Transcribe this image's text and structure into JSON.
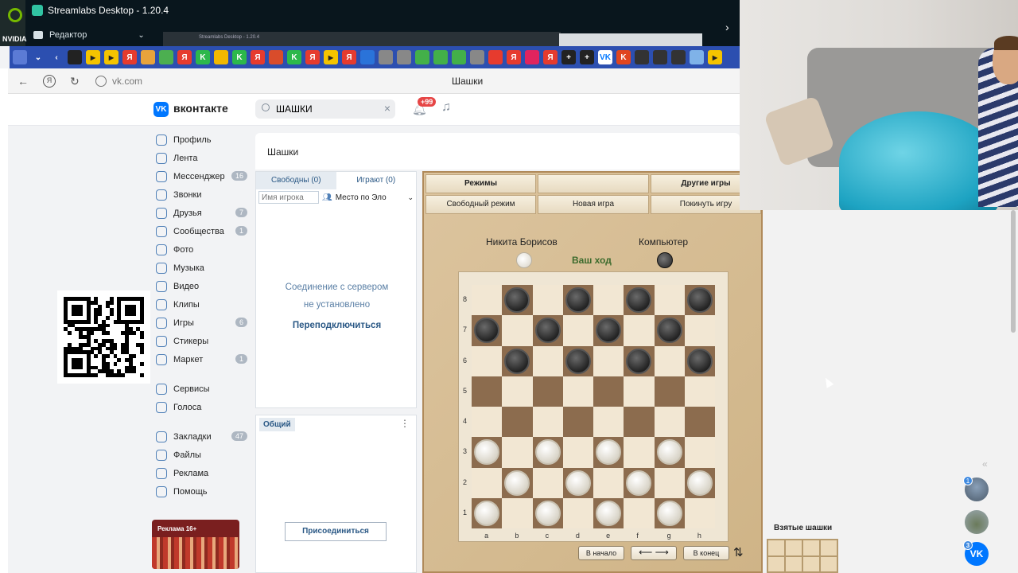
{
  "streamlabs": {
    "nvidia_label": "NVIDIA",
    "app_title": "Streamlabs Desktop - 1.20.4",
    "editor_label": "Редактор",
    "preview_title": "Streamlabs Desktop - 1.20.4"
  },
  "bookmarks": [
    {
      "icon": "smiley-icon",
      "color": "#5b7bd5"
    },
    {
      "icon": "chevron-down-icon",
      "color": "#2c4fb0"
    },
    {
      "icon": "back-icon",
      "color": "#2c4fb0"
    },
    {
      "icon": "bookmark-icon",
      "color": "#222"
    },
    {
      "icon": "play-icon",
      "color": "#f5c400"
    },
    {
      "icon": "play-icon",
      "color": "#f5c400"
    },
    {
      "icon": "yandex-icon",
      "color": "#e63b2e"
    },
    {
      "icon": "grid-icon",
      "color": "#e8a33b"
    },
    {
      "icon": "grid-icon",
      "color": "#4caf50"
    },
    {
      "icon": "yandex-icon",
      "color": "#e63b2e"
    },
    {
      "icon": "k-icon",
      "color": "#2db84b"
    },
    {
      "icon": "m-icon",
      "color": "#f2b800"
    },
    {
      "icon": "k-icon",
      "color": "#2db84b"
    },
    {
      "icon": "yandex-icon",
      "color": "#e63b2e"
    },
    {
      "icon": "circle-icon",
      "color": "#d94c2b"
    },
    {
      "icon": "k-icon",
      "color": "#2db84b"
    },
    {
      "icon": "yandex-icon",
      "color": "#e63b2e"
    },
    {
      "icon": "play-icon",
      "color": "#f5c400"
    },
    {
      "icon": "yandex-icon",
      "color": "#e63b2e"
    },
    {
      "icon": "mp-icon",
      "color": "#2a73d9"
    },
    {
      "icon": "clock-icon",
      "color": "#888"
    },
    {
      "icon": "clock-icon",
      "color": "#888"
    },
    {
      "icon": "ok-icon",
      "color": "#43b049"
    },
    {
      "icon": "ok-icon",
      "color": "#43b049"
    },
    {
      "icon": "ok-icon",
      "color": "#43b049"
    },
    {
      "icon": "clock-icon",
      "color": "#888"
    },
    {
      "icon": "pin-icon",
      "color": "#e63b2e"
    },
    {
      "icon": "yandex-icon",
      "color": "#e63b2e"
    },
    {
      "icon": "n-icon",
      "color": "#e0245e"
    },
    {
      "icon": "yandex-icon",
      "color": "#e63b2e"
    },
    {
      "icon": "plus-icon",
      "color": "#222"
    },
    {
      "icon": "plus-icon",
      "color": "#222"
    },
    {
      "icon": "vk-icon",
      "color": "#0077ff"
    },
    {
      "icon": "k-icon",
      "color": "#e0451f"
    },
    {
      "icon": "face-icon",
      "color": "#333"
    },
    {
      "icon": "face-icon",
      "color": "#333"
    },
    {
      "icon": "face-icon",
      "color": "#333"
    },
    {
      "icon": "check-icon",
      "color": "#7fb2e8"
    },
    {
      "icon": "play-icon",
      "color": "#f5c400"
    }
  ],
  "browser": {
    "url": "vk.com",
    "tab_title": "Шашки",
    "yandex_glyph": "Я"
  },
  "vk": {
    "logo_glyph": "VK",
    "logo_text": "вконтакте",
    "search_value": "ШАШКИ",
    "notifications_badge": "+99"
  },
  "sidebar": {
    "items": [
      {
        "label": "Профиль",
        "count": ""
      },
      {
        "label": "Лента",
        "count": ""
      },
      {
        "label": "Мессенджер",
        "count": "16"
      },
      {
        "label": "Звонки",
        "count": ""
      },
      {
        "label": "Друзья",
        "count": "7"
      },
      {
        "label": "Сообщества",
        "count": "1"
      },
      {
        "label": "Фото",
        "count": ""
      },
      {
        "label": "Музыка",
        "count": ""
      },
      {
        "label": "Видео",
        "count": ""
      },
      {
        "label": "Клипы",
        "count": ""
      },
      {
        "label": "Игры",
        "count": "6"
      },
      {
        "label": "Стикеры",
        "count": ""
      },
      {
        "label": "Маркет",
        "count": "1"
      }
    ],
    "items2": [
      {
        "label": "Сервисы",
        "count": ""
      },
      {
        "label": "Голоса",
        "count": ""
      }
    ],
    "items3": [
      {
        "label": "Закладки",
        "count": "47"
      },
      {
        "label": "Файлы",
        "count": ""
      },
      {
        "label": "Реклама",
        "count": ""
      },
      {
        "label": "Помощь",
        "count": ""
      }
    ],
    "ad_label": "Реклама 16+"
  },
  "game_page": {
    "title": "Шашки"
  },
  "players": {
    "tab_free": "Свободны (0)",
    "tab_playing": "Играют (0)",
    "name_placeholder": "Имя игрока",
    "sort_label": "Место по Эло",
    "connection_message_1": "Соединение с сервером",
    "connection_message_2": "не установлено",
    "reconnect_label": "Переподключиться"
  },
  "chat": {
    "tab_label": "Общий",
    "join_label": "Присоединиться"
  },
  "game": {
    "menu_modes": "Режимы",
    "menu_other_games": "Другие игры",
    "menu_free_mode": "Свободный режим",
    "menu_new_game": "Новая игра",
    "menu_leave": "Покинуть игру",
    "player_left": "Никита Борисов",
    "player_right": "Компьютер",
    "turn_text": "Ваш ход",
    "files": [
      "a",
      "b",
      "c",
      "d",
      "e",
      "f",
      "g",
      "h"
    ],
    "ranks": [
      "8",
      "7",
      "6",
      "5",
      "4",
      "3",
      "2",
      "1"
    ],
    "board": [
      ".b.b.b.b",
      "b.b.b.b.",
      ".b.b.b.b",
      "........",
      "........",
      "w.w.w.w.",
      ".w.w.w.w",
      "w.w.w.w."
    ],
    "btn_start": "В начало",
    "btn_arrows": "⟵ ⟶",
    "btn_end": "В конец",
    "btn_flip": "⇅",
    "captured_title": "Взятые шашки"
  },
  "right_chats": [
    {
      "badge": "1"
    },
    {
      "badge": ""
    },
    {
      "badge": "3",
      "glyph": "VK"
    }
  ]
}
